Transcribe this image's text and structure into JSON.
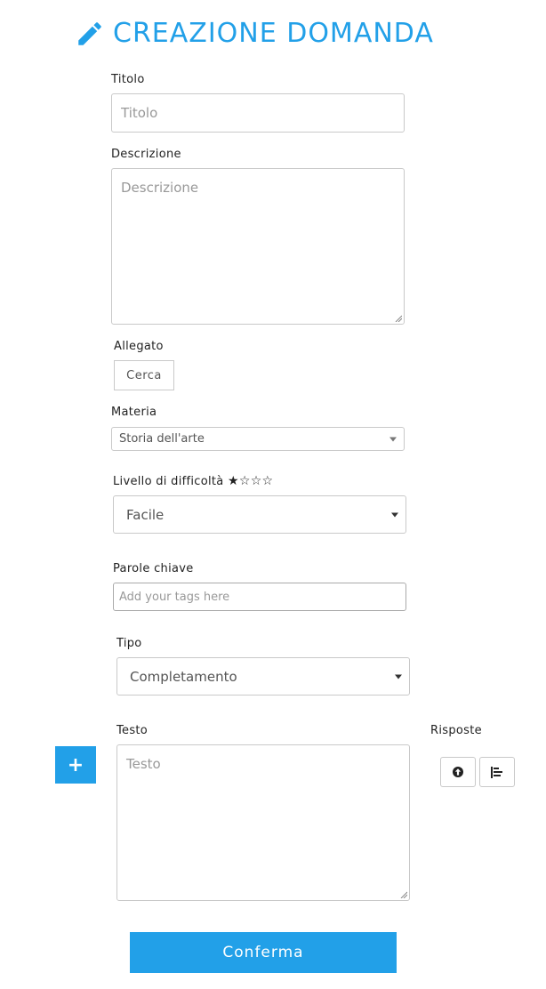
{
  "header": {
    "icon": "pencil-icon",
    "title": "CREAZIONE DOMANDA",
    "accent_color": "#22a0e8"
  },
  "fields": {
    "titolo": {
      "label": "Titolo",
      "placeholder": "Titolo"
    },
    "descrizione": {
      "label": "Descrizione",
      "placeholder": "Descrizione"
    },
    "allegato": {
      "label": "Allegato",
      "button_label": "Cerca"
    },
    "materia": {
      "label": "Materia",
      "value": "Storia dell'arte"
    },
    "livello": {
      "label": "Livello di difficoltà",
      "stars": "★☆☆☆",
      "value": "Facile"
    },
    "parole_chiave": {
      "label": "Parole chiave",
      "placeholder": "Add your tags here"
    },
    "tipo": {
      "label": "Tipo",
      "value": "Completamento"
    },
    "testo": {
      "label": "Testo",
      "placeholder": "Testo"
    }
  },
  "risposte": {
    "label": "Risposte",
    "buttons": [
      "upload-icon",
      "align-left-icon"
    ]
  },
  "add_button": {
    "label": "+"
  },
  "confirm_button": {
    "label": "Conferma"
  }
}
